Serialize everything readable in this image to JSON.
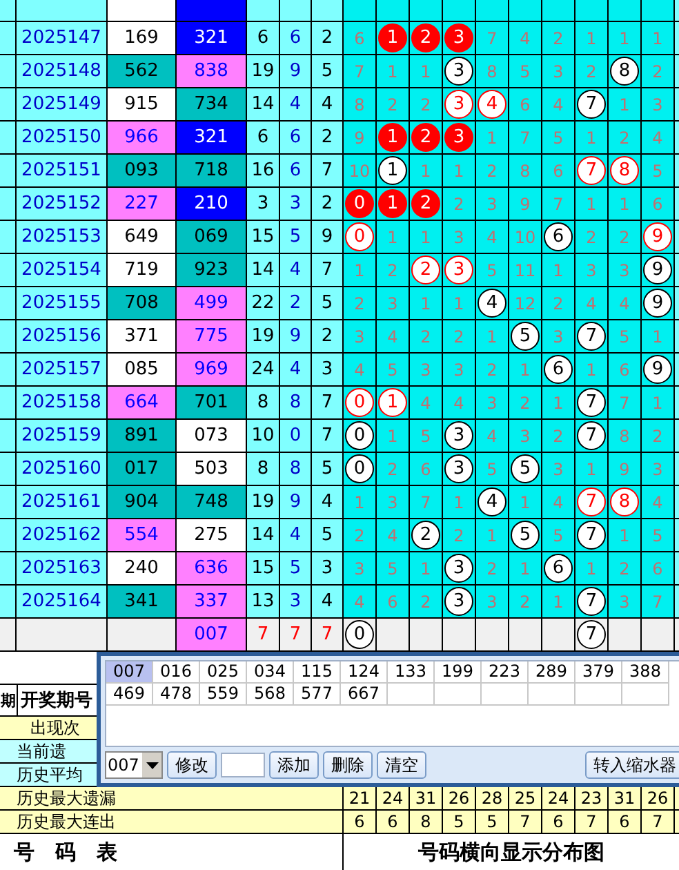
{
  "rows": [
    {
      "period": "2025147",
      "num1": {
        "value": "169",
        "color": "#ffffff"
      },
      "num2": {
        "value": "321",
        "color": "#0000ff"
      },
      "stats": [
        "6",
        "6",
        "2"
      ],
      "digits": [
        {
          "value": "6",
          "kind": "miss"
        },
        {
          "value": "1",
          "kind": "hit_fill"
        },
        {
          "value": "2",
          "kind": "hit_fill"
        },
        {
          "value": "3",
          "kind": "hit_fill"
        },
        {
          "value": "7",
          "kind": "miss"
        },
        {
          "value": "4",
          "kind": "miss"
        },
        {
          "value": "2",
          "kind": "miss"
        },
        {
          "value": "1",
          "kind": "miss"
        },
        {
          "value": "1",
          "kind": "miss"
        },
        {
          "value": "1",
          "kind": "miss"
        }
      ]
    },
    {
      "period": "2025148",
      "num1": {
        "value": "562",
        "color": "#00c0c0"
      },
      "num2": {
        "value": "838",
        "color": "#ff80ff"
      },
      "stats": [
        "19",
        "9",
        "5"
      ],
      "digits": [
        {
          "value": "7",
          "kind": "miss"
        },
        {
          "value": "1",
          "kind": "miss"
        },
        {
          "value": "1",
          "kind": "miss"
        },
        {
          "value": "3",
          "kind": "hit"
        },
        {
          "value": "8",
          "kind": "miss"
        },
        {
          "value": "5",
          "kind": "miss"
        },
        {
          "value": "3",
          "kind": "miss"
        },
        {
          "value": "2",
          "kind": "miss"
        },
        {
          "value": "8",
          "kind": "hit"
        },
        {
          "value": "2",
          "kind": "miss"
        }
      ]
    },
    {
      "period": "2025149",
      "num1": {
        "value": "915",
        "color": "#ffffff"
      },
      "num2": {
        "value": "734",
        "color": "#00c0c0"
      },
      "stats": [
        "14",
        "4",
        "4"
      ],
      "digits": [
        {
          "value": "8",
          "kind": "miss"
        },
        {
          "value": "2",
          "kind": "miss"
        },
        {
          "value": "2",
          "kind": "miss"
        },
        {
          "value": "3",
          "kind": "hit_red"
        },
        {
          "value": "4",
          "kind": "hit_red"
        },
        {
          "value": "6",
          "kind": "miss"
        },
        {
          "value": "4",
          "kind": "miss"
        },
        {
          "value": "7",
          "kind": "hit"
        },
        {
          "value": "1",
          "kind": "miss"
        },
        {
          "value": "3",
          "kind": "miss"
        }
      ]
    },
    {
      "period": "2025150",
      "num1": {
        "value": "966",
        "color": "#ff80ff"
      },
      "num2": {
        "value": "321",
        "color": "#0000ff"
      },
      "stats": [
        "6",
        "6",
        "2"
      ],
      "digits": [
        {
          "value": "9",
          "kind": "miss"
        },
        {
          "value": "1",
          "kind": "hit_fill"
        },
        {
          "value": "2",
          "kind": "hit_fill"
        },
        {
          "value": "3",
          "kind": "hit_fill"
        },
        {
          "value": "1",
          "kind": "miss"
        },
        {
          "value": "7",
          "kind": "miss"
        },
        {
          "value": "5",
          "kind": "miss"
        },
        {
          "value": "1",
          "kind": "miss"
        },
        {
          "value": "2",
          "kind": "miss"
        },
        {
          "value": "4",
          "kind": "miss"
        }
      ]
    },
    {
      "period": "2025151",
      "num1": {
        "value": "093",
        "color": "#00c0c0"
      },
      "num2": {
        "value": "718",
        "color": "#00c0c0"
      },
      "stats": [
        "16",
        "6",
        "7"
      ],
      "digits": [
        {
          "value": "10",
          "kind": "miss"
        },
        {
          "value": "1",
          "kind": "hit"
        },
        {
          "value": "1",
          "kind": "miss"
        },
        {
          "value": "1",
          "kind": "miss"
        },
        {
          "value": "2",
          "kind": "miss"
        },
        {
          "value": "8",
          "kind": "miss"
        },
        {
          "value": "6",
          "kind": "miss"
        },
        {
          "value": "7",
          "kind": "hit_red"
        },
        {
          "value": "8",
          "kind": "hit_red"
        },
        {
          "value": "5",
          "kind": "miss"
        }
      ]
    },
    {
      "period": "2025152",
      "num1": {
        "value": "227",
        "color": "#ff80ff"
      },
      "num2": {
        "value": "210",
        "color": "#0000ff"
      },
      "stats": [
        "3",
        "3",
        "2"
      ],
      "digits": [
        {
          "value": "0",
          "kind": "hit_fill"
        },
        {
          "value": "1",
          "kind": "hit_fill"
        },
        {
          "value": "2",
          "kind": "hit_fill"
        },
        {
          "value": "2",
          "kind": "miss"
        },
        {
          "value": "3",
          "kind": "miss"
        },
        {
          "value": "9",
          "kind": "miss"
        },
        {
          "value": "7",
          "kind": "miss"
        },
        {
          "value": "1",
          "kind": "miss"
        },
        {
          "value": "1",
          "kind": "miss"
        },
        {
          "value": "6",
          "kind": "miss"
        }
      ]
    },
    {
      "period": "2025153",
      "num1": {
        "value": "649",
        "color": "#ffffff"
      },
      "num2": {
        "value": "069",
        "color": "#00c0c0"
      },
      "stats": [
        "15",
        "5",
        "9"
      ],
      "digits": [
        {
          "value": "0",
          "kind": "hit_red"
        },
        {
          "value": "1",
          "kind": "miss"
        },
        {
          "value": "1",
          "kind": "miss"
        },
        {
          "value": "3",
          "kind": "miss"
        },
        {
          "value": "4",
          "kind": "miss"
        },
        {
          "value": "10",
          "kind": "miss"
        },
        {
          "value": "6",
          "kind": "hit"
        },
        {
          "value": "2",
          "kind": "miss"
        },
        {
          "value": "2",
          "kind": "miss"
        },
        {
          "value": "9",
          "kind": "hit_red"
        }
      ]
    },
    {
      "period": "2025154",
      "num1": {
        "value": "719",
        "color": "#ffffff"
      },
      "num2": {
        "value": "923",
        "color": "#00c0c0"
      },
      "stats": [
        "14",
        "4",
        "7"
      ],
      "digits": [
        {
          "value": "1",
          "kind": "miss"
        },
        {
          "value": "2",
          "kind": "miss"
        },
        {
          "value": "2",
          "kind": "hit_red"
        },
        {
          "value": "3",
          "kind": "hit_red"
        },
        {
          "value": "5",
          "kind": "miss"
        },
        {
          "value": "11",
          "kind": "miss"
        },
        {
          "value": "1",
          "kind": "miss"
        },
        {
          "value": "3",
          "kind": "miss"
        },
        {
          "value": "3",
          "kind": "miss"
        },
        {
          "value": "9",
          "kind": "hit"
        }
      ]
    },
    {
      "period": "2025155",
      "num1": {
        "value": "708",
        "color": "#00c0c0"
      },
      "num2": {
        "value": "499",
        "color": "#ff80ff"
      },
      "stats": [
        "22",
        "2",
        "5"
      ],
      "digits": [
        {
          "value": "2",
          "kind": "miss"
        },
        {
          "value": "3",
          "kind": "miss"
        },
        {
          "value": "1",
          "kind": "miss"
        },
        {
          "value": "1",
          "kind": "miss"
        },
        {
          "value": "4",
          "kind": "hit"
        },
        {
          "value": "12",
          "kind": "miss"
        },
        {
          "value": "2",
          "kind": "miss"
        },
        {
          "value": "4",
          "kind": "miss"
        },
        {
          "value": "4",
          "kind": "miss"
        },
        {
          "value": "9",
          "kind": "hit"
        }
      ]
    },
    {
      "period": "2025156",
      "num1": {
        "value": "371",
        "color": "#ffffff"
      },
      "num2": {
        "value": "775",
        "color": "#ff80ff"
      },
      "stats": [
        "19",
        "9",
        "2"
      ],
      "digits": [
        {
          "value": "3",
          "kind": "miss"
        },
        {
          "value": "4",
          "kind": "miss"
        },
        {
          "value": "2",
          "kind": "miss"
        },
        {
          "value": "2",
          "kind": "miss"
        },
        {
          "value": "1",
          "kind": "miss"
        },
        {
          "value": "5",
          "kind": "hit"
        },
        {
          "value": "3",
          "kind": "miss"
        },
        {
          "value": "7",
          "kind": "hit"
        },
        {
          "value": "5",
          "kind": "miss"
        },
        {
          "value": "1",
          "kind": "miss"
        }
      ]
    },
    {
      "period": "2025157",
      "num1": {
        "value": "085",
        "color": "#ffffff"
      },
      "num2": {
        "value": "969",
        "color": "#ff80ff"
      },
      "stats": [
        "24",
        "4",
        "3"
      ],
      "digits": [
        {
          "value": "4",
          "kind": "miss"
        },
        {
          "value": "5",
          "kind": "miss"
        },
        {
          "value": "3",
          "kind": "miss"
        },
        {
          "value": "3",
          "kind": "miss"
        },
        {
          "value": "2",
          "kind": "miss"
        },
        {
          "value": "1",
          "kind": "miss"
        },
        {
          "value": "6",
          "kind": "hit"
        },
        {
          "value": "1",
          "kind": "miss"
        },
        {
          "value": "6",
          "kind": "miss"
        },
        {
          "value": "9",
          "kind": "hit"
        }
      ]
    },
    {
      "period": "2025158",
      "num1": {
        "value": "664",
        "color": "#ff80ff"
      },
      "num2": {
        "value": "701",
        "color": "#00c0c0"
      },
      "stats": [
        "8",
        "8",
        "7"
      ],
      "digits": [
        {
          "value": "0",
          "kind": "hit_red"
        },
        {
          "value": "1",
          "kind": "hit_red"
        },
        {
          "value": "4",
          "kind": "miss"
        },
        {
          "value": "4",
          "kind": "miss"
        },
        {
          "value": "3",
          "kind": "miss"
        },
        {
          "value": "2",
          "kind": "miss"
        },
        {
          "value": "1",
          "kind": "miss"
        },
        {
          "value": "7",
          "kind": "hit"
        },
        {
          "value": "7",
          "kind": "miss"
        },
        {
          "value": "1",
          "kind": "miss"
        }
      ]
    },
    {
      "period": "2025159",
      "num1": {
        "value": "891",
        "color": "#00c0c0"
      },
      "num2": {
        "value": "073",
        "color": "#ffffff"
      },
      "stats": [
        "10",
        "0",
        "7"
      ],
      "digits": [
        {
          "value": "0",
          "kind": "hit"
        },
        {
          "value": "1",
          "kind": "miss"
        },
        {
          "value": "5",
          "kind": "miss"
        },
        {
          "value": "3",
          "kind": "hit"
        },
        {
          "value": "4",
          "kind": "miss"
        },
        {
          "value": "3",
          "kind": "miss"
        },
        {
          "value": "2",
          "kind": "miss"
        },
        {
          "value": "7",
          "kind": "hit"
        },
        {
          "value": "8",
          "kind": "miss"
        },
        {
          "value": "2",
          "kind": "miss"
        }
      ]
    },
    {
      "period": "2025160",
      "num1": {
        "value": "017",
        "color": "#00c0c0"
      },
      "num2": {
        "value": "503",
        "color": "#ffffff"
      },
      "stats": [
        "8",
        "8",
        "5"
      ],
      "digits": [
        {
          "value": "0",
          "kind": "hit"
        },
        {
          "value": "2",
          "kind": "miss"
        },
        {
          "value": "6",
          "kind": "miss"
        },
        {
          "value": "3",
          "kind": "hit"
        },
        {
          "value": "5",
          "kind": "miss"
        },
        {
          "value": "5",
          "kind": "hit"
        },
        {
          "value": "3",
          "kind": "miss"
        },
        {
          "value": "1",
          "kind": "miss"
        },
        {
          "value": "9",
          "kind": "miss"
        },
        {
          "value": "3",
          "kind": "miss"
        }
      ]
    },
    {
      "period": "2025161",
      "num1": {
        "value": "904",
        "color": "#00c0c0"
      },
      "num2": {
        "value": "748",
        "color": "#00c0c0"
      },
      "stats": [
        "19",
        "9",
        "4"
      ],
      "digits": [
        {
          "value": "1",
          "kind": "miss"
        },
        {
          "value": "3",
          "kind": "miss"
        },
        {
          "value": "7",
          "kind": "miss"
        },
        {
          "value": "1",
          "kind": "miss"
        },
        {
          "value": "4",
          "kind": "hit"
        },
        {
          "value": "1",
          "kind": "miss"
        },
        {
          "value": "4",
          "kind": "miss"
        },
        {
          "value": "7",
          "kind": "hit_red"
        },
        {
          "value": "8",
          "kind": "hit_red"
        },
        {
          "value": "4",
          "kind": "miss"
        }
      ]
    },
    {
      "period": "2025162",
      "num1": {
        "value": "554",
        "color": "#ff80ff"
      },
      "num2": {
        "value": "275",
        "color": "#ffffff"
      },
      "stats": [
        "14",
        "4",
        "5"
      ],
      "digits": [
        {
          "value": "2",
          "kind": "miss"
        },
        {
          "value": "4",
          "kind": "miss"
        },
        {
          "value": "2",
          "kind": "hit"
        },
        {
          "value": "2",
          "kind": "miss"
        },
        {
          "value": "1",
          "kind": "miss"
        },
        {
          "value": "5",
          "kind": "hit"
        },
        {
          "value": "5",
          "kind": "miss"
        },
        {
          "value": "7",
          "kind": "hit"
        },
        {
          "value": "1",
          "kind": "miss"
        },
        {
          "value": "5",
          "kind": "miss"
        }
      ]
    },
    {
      "period": "2025163",
      "num1": {
        "value": "240",
        "color": "#ffffff"
      },
      "num2": {
        "value": "636",
        "color": "#ff80ff"
      },
      "stats": [
        "15",
        "5",
        "3"
      ],
      "digits": [
        {
          "value": "3",
          "kind": "miss"
        },
        {
          "value": "5",
          "kind": "miss"
        },
        {
          "value": "1",
          "kind": "miss"
        },
        {
          "value": "3",
          "kind": "hit"
        },
        {
          "value": "2",
          "kind": "miss"
        },
        {
          "value": "1",
          "kind": "miss"
        },
        {
          "value": "6",
          "kind": "hit"
        },
        {
          "value": "1",
          "kind": "miss"
        },
        {
          "value": "2",
          "kind": "miss"
        },
        {
          "value": "6",
          "kind": "miss"
        }
      ]
    },
    {
      "period": "2025164",
      "num1": {
        "value": "341",
        "color": "#00c0c0"
      },
      "num2": {
        "value": "337",
        "color": "#ff80ff"
      },
      "stats": [
        "13",
        "3",
        "4"
      ],
      "digits": [
        {
          "value": "4",
          "kind": "miss"
        },
        {
          "value": "6",
          "kind": "miss"
        },
        {
          "value": "2",
          "kind": "miss"
        },
        {
          "value": "3",
          "kind": "hit"
        },
        {
          "value": "3",
          "kind": "miss"
        },
        {
          "value": "2",
          "kind": "miss"
        },
        {
          "value": "1",
          "kind": "miss"
        },
        {
          "value": "7",
          "kind": "hit"
        },
        {
          "value": "3",
          "kind": "miss"
        },
        {
          "value": "7",
          "kind": "miss"
        }
      ]
    }
  ],
  "forecast": {
    "num2": {
      "value": "007",
      "color": "#ff80ff"
    },
    "stats": [
      "7",
      "7",
      "7"
    ],
    "digits": [
      {
        "value": "0",
        "kind": "hit"
      },
      {
        "kind": "blank"
      },
      {
        "kind": "blank"
      },
      {
        "kind": "blank"
      },
      {
        "kind": "blank"
      },
      {
        "kind": "blank"
      },
      {
        "kind": "blank"
      },
      {
        "value": "7",
        "kind": "hit"
      },
      {
        "kind": "blank"
      },
      {
        "kind": "blank"
      }
    ]
  },
  "header": {
    "column_1": "期",
    "column_2": "开奖期号"
  },
  "side_labels": [
    "出现次",
    "当前遗",
    "历史平均"
  ],
  "stat_rows": [
    {
      "label": "历史最大遗漏",
      "values": [
        "21",
        "24",
        "31",
        "26",
        "28",
        "25",
        "24",
        "23",
        "31",
        "26"
      ]
    },
    {
      "label": "历史最大连出",
      "values": [
        "6",
        "6",
        "8",
        "5",
        "5",
        "7",
        "6",
        "7",
        "6",
        "7"
      ]
    }
  ],
  "footer": [
    "号　码　表",
    "号码横向显示分布图"
  ],
  "dialog": {
    "numbers": [
      {
        "value": "007",
        "selected": true
      },
      {
        "value": "016",
        "selected": false
      },
      {
        "value": "025",
        "selected": false
      },
      {
        "value": "034",
        "selected": false
      },
      {
        "value": "115",
        "selected": false
      },
      {
        "value": "124",
        "selected": false
      },
      {
        "value": "133",
        "selected": false
      },
      {
        "value": "199",
        "selected": false
      },
      {
        "value": "223",
        "selected": false
      },
      {
        "value": "289",
        "selected": false
      },
      {
        "value": "379",
        "selected": false
      },
      {
        "value": "388",
        "selected": false
      },
      {
        "value": "469",
        "selected": false
      },
      {
        "value": "478",
        "selected": false
      },
      {
        "value": "559",
        "selected": false
      },
      {
        "value": "568",
        "selected": false
      },
      {
        "value": "577",
        "selected": false
      },
      {
        "value": "667",
        "selected": false
      }
    ],
    "dropdown": {
      "value": "007"
    },
    "buttons": [
      "修改",
      "添加",
      "删除",
      "清空"
    ],
    "export_button": "转入缩水器"
  }
}
